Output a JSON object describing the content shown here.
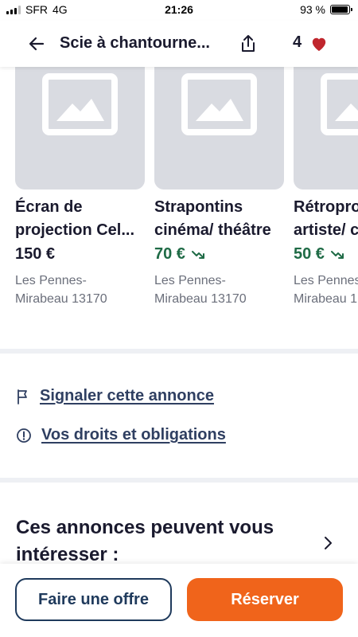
{
  "status_bar": {
    "carrier": "SFR",
    "network": "4G",
    "time": "21:26",
    "battery": "93 %",
    "battery_level": 0.93
  },
  "header": {
    "title": "Scie à chantourne...",
    "favorites_count": "4"
  },
  "carousel": {
    "cards": [
      {
        "title_line1": "Écran de",
        "title_line2": "projection Cel...",
        "price": "150 €",
        "price_trend": "none",
        "location_line1": "Les Pennes-",
        "location_line2": "Mirabeau 13170"
      },
      {
        "title_line1": "Strapontins",
        "title_line2": "cinéma/ théâtre",
        "price": "70 €",
        "price_trend": "good",
        "location_line1": "Les Pennes-",
        "location_line2": "Mirabeau 13170"
      },
      {
        "title_line1": "Rétroproj",
        "title_line2": "artiste/ c",
        "price": "50 €",
        "price_trend": "good",
        "location_line1": "Les Pennes",
        "location_line2": "Mirabeau 1"
      }
    ]
  },
  "links": {
    "report": "Signaler cette annonce",
    "rights": "Vos droits et obligations"
  },
  "suggestions": {
    "title": "Ces annonces peuvent vous intéresser :"
  },
  "actions": {
    "offer_label": "Faire une offre",
    "reserve_label": "Réserver"
  },
  "colors": {
    "accent_orange": "#f0641b",
    "navy": "#1f3a5c",
    "good_price_green": "#1f6b46",
    "heart_red": "#c0262d",
    "placeholder_grey": "#d9dbe1"
  }
}
